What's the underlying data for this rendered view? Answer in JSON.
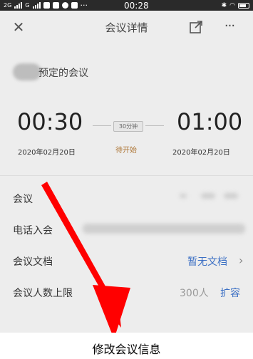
{
  "status_bar": {
    "carrier1": "2G",
    "carrier2": "G",
    "dots": "···",
    "time": "00:28"
  },
  "nav": {
    "close_icon": "close-icon",
    "title": "会议详情",
    "share_icon": "external-link-icon",
    "more_icon": "more-icon",
    "more_label": "···"
  },
  "meeting": {
    "organizer_suffix": "预定的会议",
    "start_time": "00:30",
    "start_date": "2020年02月20日",
    "duration": "30分钟",
    "status": "待开始",
    "end_time": "01:00",
    "end_date": "2020年02月20日"
  },
  "details": {
    "meeting_id_label": "会议",
    "dial_in_label": "电话入会",
    "documents_label": "会议文档",
    "documents_value": "暂无文档",
    "capacity_label": "会议人数上限",
    "capacity_value": "300人",
    "expand_label": "扩容"
  },
  "caption": "修改会议信息",
  "colors": {
    "link": "#3b6fc4",
    "status": "#b07a3c",
    "arrow": "#ff0000"
  }
}
